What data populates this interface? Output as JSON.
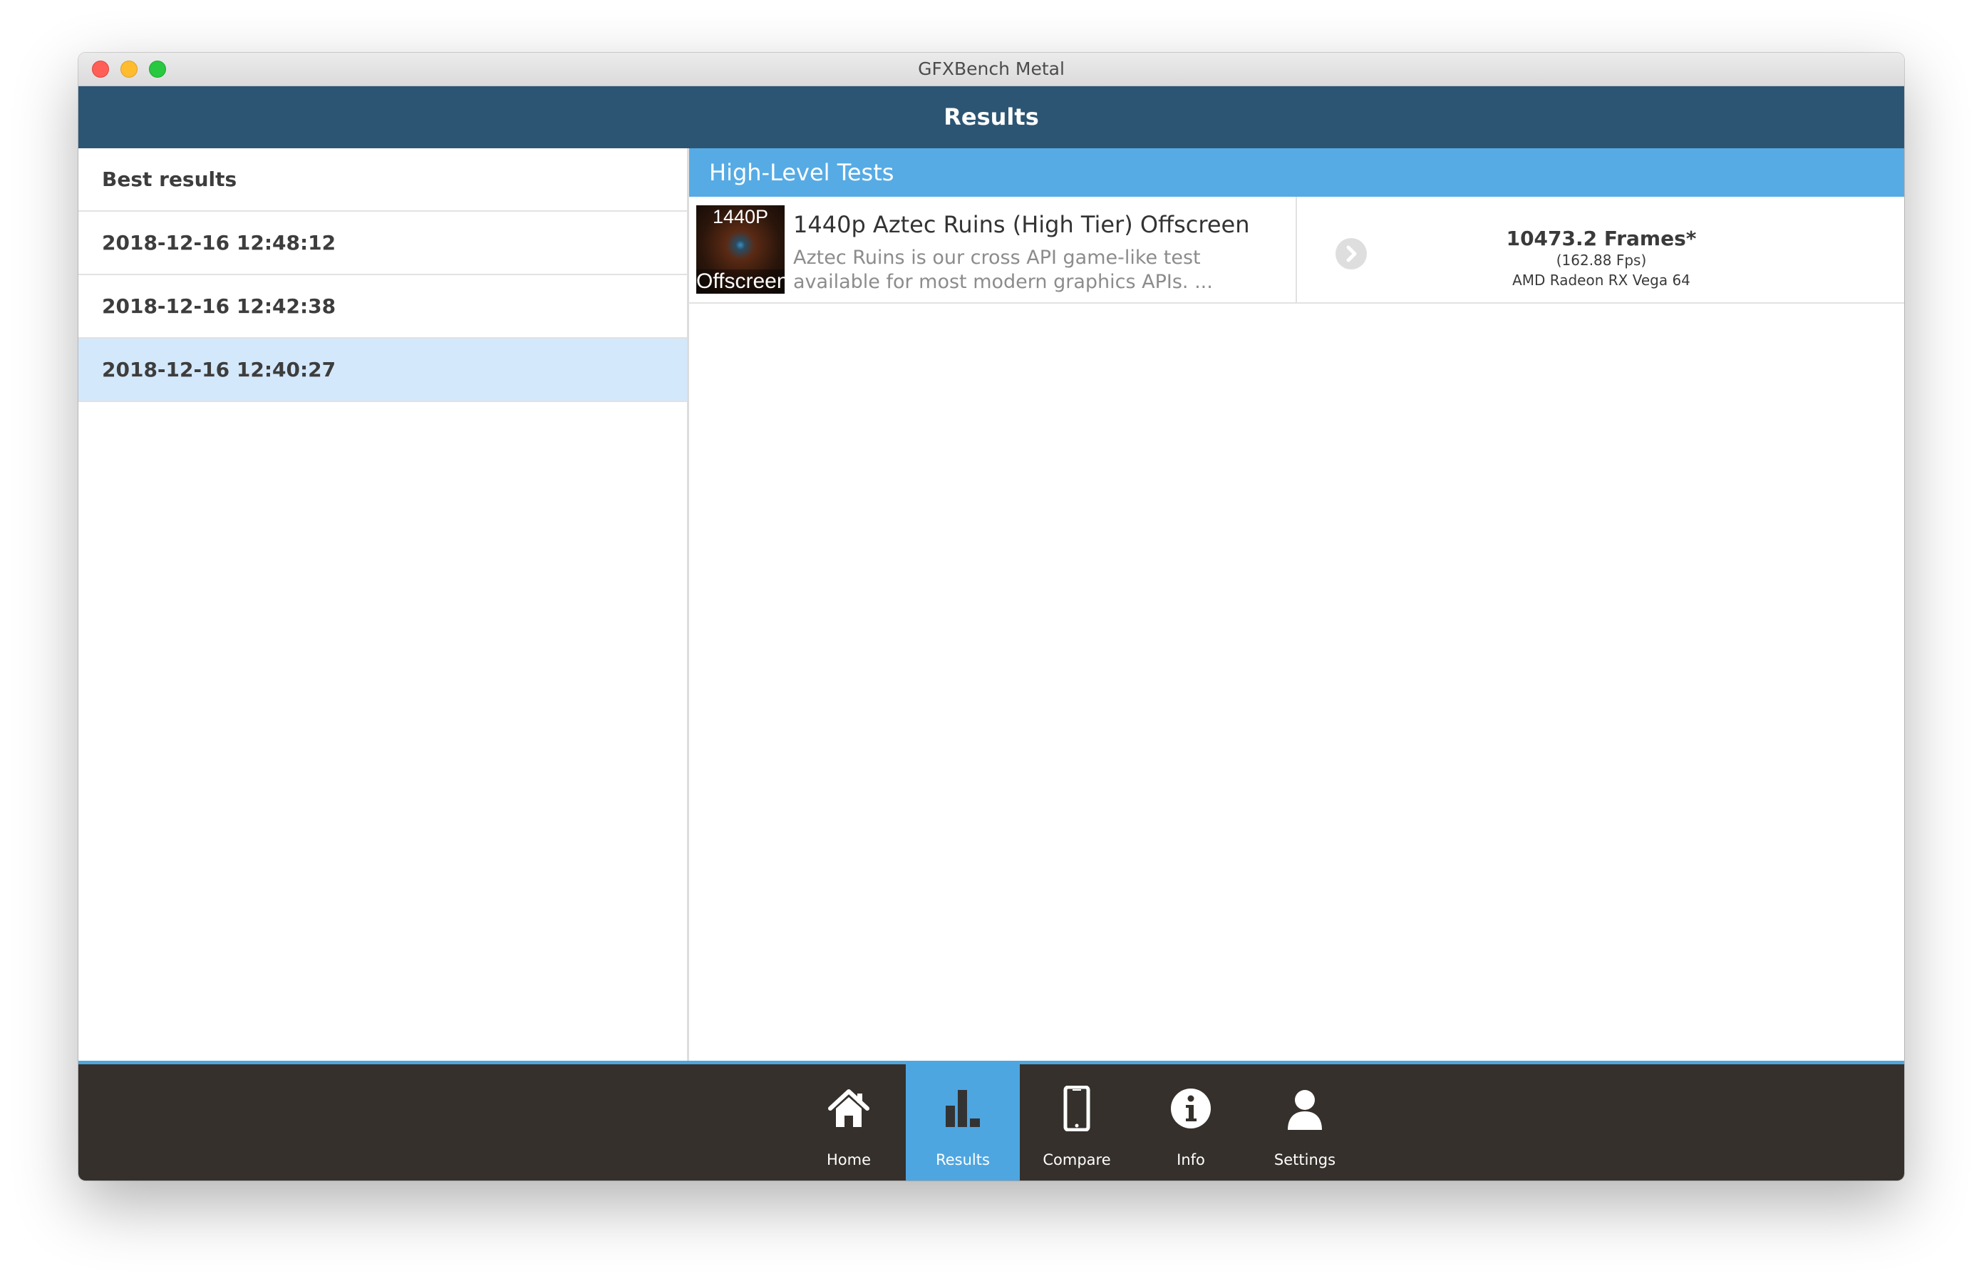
{
  "window": {
    "title": "GFXBench Metal"
  },
  "header": {
    "title": "Results"
  },
  "sidebar": {
    "items": [
      {
        "label": "Best results"
      },
      {
        "label": "2018-12-16 12:48:12"
      },
      {
        "label": "2018-12-16 12:42:38"
      },
      {
        "label": "2018-12-16 12:40:27",
        "selected": true
      }
    ]
  },
  "main": {
    "section_title": "High-Level Tests",
    "tests": [
      {
        "thumb_top": "1440P",
        "thumb_bottom": "Offscreen",
        "title": "1440p Aztec Ruins (High Tier) Offscreen",
        "description": "Aztec Ruins is our cross API game-like test available for most modern graphics APIs. ...",
        "score": "10473.2 Frames*",
        "fps": "(162.88 Fps)",
        "device": "AMD Radeon RX Vega 64"
      }
    ]
  },
  "tabbar": {
    "tabs": [
      {
        "label": "Home",
        "icon": "home-icon"
      },
      {
        "label": "Results",
        "icon": "bar-chart-icon",
        "active": true
      },
      {
        "label": "Compare",
        "icon": "phone-icon"
      },
      {
        "label": "Info",
        "icon": "info-icon"
      },
      {
        "label": "Settings",
        "icon": "user-icon"
      }
    ]
  },
  "colors": {
    "header": "#2c5574",
    "accent": "#4ea6e0",
    "section_header": "#56abe4",
    "selected_row": "#d4e8fb",
    "tabbar": "#35302b"
  }
}
